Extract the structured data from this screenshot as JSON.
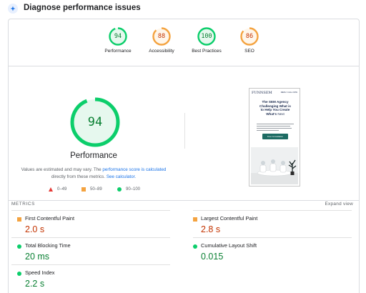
{
  "header": {
    "title": "Diagnose performance issues",
    "icon": "speed-insights-icon"
  },
  "summary_gauges": [
    {
      "label": "Performance",
      "score": "94",
      "fraction": 0.94,
      "color": "#0cce6b",
      "text_color": "#0a8033",
      "bg": "#e6f8ee"
    },
    {
      "label": "Accessibility",
      "score": "88",
      "fraction": 0.88,
      "color": "#f4a340",
      "text_color": "#c33300",
      "bg": "#fff6ea"
    },
    {
      "label": "Best Practices",
      "score": "100",
      "fraction": 1.0,
      "color": "#0cce6b",
      "text_color": "#0a8033",
      "bg": "#e6f8ee"
    },
    {
      "label": "SEO",
      "score": "86",
      "fraction": 0.86,
      "color": "#f4a340",
      "text_color": "#c33300",
      "bg": "#fff6ea"
    }
  ],
  "main_gauge": {
    "label": "Performance",
    "score": "94",
    "fraction": 0.94,
    "color": "#0cce6b",
    "bg": "#e6f8ee"
  },
  "note": {
    "text_before": "Values are estimated and may vary. The ",
    "link1": "performance score is calculated",
    "text_middle": " directly from these metrics. ",
    "link2": "See calculator."
  },
  "legend": [
    {
      "range": "0–49",
      "shape": "triangle",
      "color": "#e53935"
    },
    {
      "range": "50–89",
      "shape": "square",
      "color": "#f4a340"
    },
    {
      "range": "90–100",
      "shape": "circle",
      "color": "#0cce6b"
    }
  ],
  "screenshot": {
    "logo": "FUNNSEM",
    "topright": "MENU / CALL NOW",
    "headline_line1": "The SEM Agency",
    "headline_line2": "Challenging What is",
    "headline_line3": "to Help You Create",
    "headline_line4": "What's",
    "headline_light": "Next",
    "button": "Free Consultation"
  },
  "metrics": {
    "label": "METRICS",
    "expand_label": "Expand view",
    "items": [
      {
        "name": "First Contentful Paint",
        "value": "2.0 s",
        "rating": "average",
        "color": "#c33300"
      },
      {
        "name": "Largest Contentful Paint",
        "value": "2.8 s",
        "rating": "average",
        "color": "#c33300"
      },
      {
        "name": "Total Blocking Time",
        "value": "20 ms",
        "rating": "good",
        "color": "#0a8033"
      },
      {
        "name": "Cumulative Layout Shift",
        "value": "0.015",
        "rating": "good",
        "color": "#0a8033"
      },
      {
        "name": "Speed Index",
        "value": "2.2 s",
        "rating": "good",
        "color": "#0a8033"
      }
    ]
  }
}
